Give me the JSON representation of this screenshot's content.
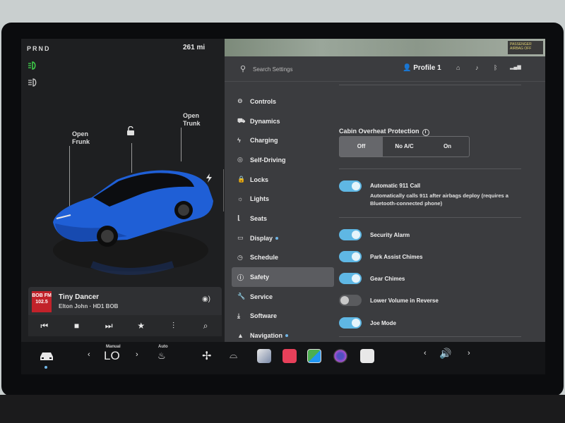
{
  "vehicle": {
    "gear": "PRND",
    "range": "261 mi",
    "open_frunk": "Open\nFrunk",
    "open_trunk": "Open\nTrunk",
    "car_color": "#1f5fd6"
  },
  "media": {
    "station_logo": "BOB FM 102.5",
    "song_title": "Tiny Dancer",
    "artist_station": "Elton John · HD1 BOB"
  },
  "map": {
    "badge": "PASSENGER AIRBAG OFF"
  },
  "header": {
    "search_placeholder": "Search Settings",
    "profile": "Profile 1"
  },
  "nav": {
    "items": [
      {
        "label": "Controls",
        "icon": "toggle-icon"
      },
      {
        "label": "Dynamics",
        "icon": "car-icon"
      },
      {
        "label": "Charging",
        "icon": "bolt-icon"
      },
      {
        "label": "Self-Driving",
        "icon": "steering-wheel-icon"
      },
      {
        "label": "Locks",
        "icon": "lock-icon"
      },
      {
        "label": "Lights",
        "icon": "sun-icon"
      },
      {
        "label": "Seats",
        "icon": "seat-icon"
      },
      {
        "label": "Display",
        "icon": "display-icon"
      },
      {
        "label": "Schedule",
        "icon": "clock-icon"
      },
      {
        "label": "Safety",
        "icon": "info-icon",
        "active": true
      },
      {
        "label": "Service",
        "icon": "wrench-icon"
      },
      {
        "label": "Software",
        "icon": "download-icon"
      },
      {
        "label": "Navigation",
        "icon": "navigation-icon"
      }
    ]
  },
  "safety": {
    "cabin_label": "Cabin Overheat Protection",
    "cabin_options": [
      "Off",
      "No A/C",
      "On"
    ],
    "cabin_selected": "Off",
    "auto911_label": "Automatic 911 Call",
    "auto911_desc": "Automatically calls 911 after airbags deploy (requires a Bluetooth-connected phone)",
    "toggles": [
      {
        "label": "Security Alarm",
        "on": true
      },
      {
        "label": "Park Assist Chimes",
        "on": true
      },
      {
        "label": "Gear Chimes",
        "on": true
      },
      {
        "label": "Lower Volume in Reverse",
        "on": false
      },
      {
        "label": "Joe Mode",
        "on": true
      }
    ]
  },
  "dock": {
    "climate_mode": "Manual",
    "temperature": "LO",
    "seat_heat_mode": "Auto"
  },
  "colors": {
    "accent_toggle": "#5fb7e4",
    "car_blue": "#1f5fd6"
  }
}
